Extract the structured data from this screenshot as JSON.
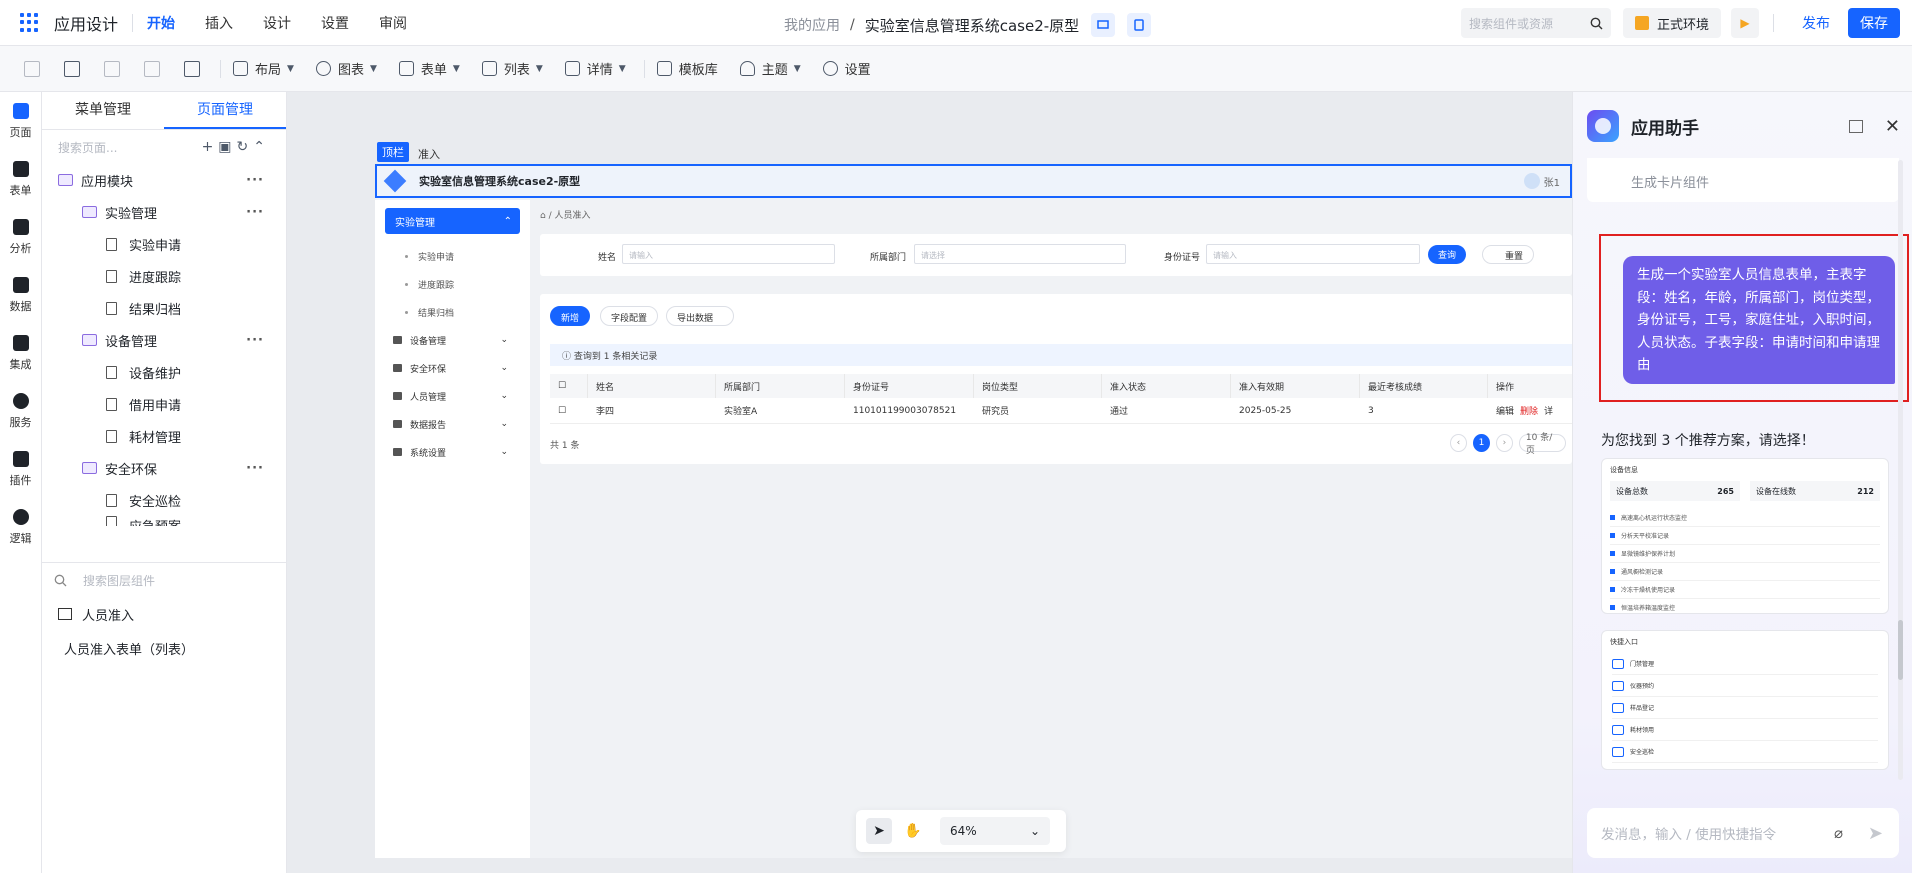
{
  "topbar": {
    "app_title": "应用设计",
    "menu": [
      "开始",
      "插入",
      "设计",
      "设置",
      "审阅"
    ],
    "crumb": "我的应用",
    "app_name": "实验室信息管理系统case2-原型",
    "search_placeholder": "搜索组件或资源",
    "env_label": "正式环境",
    "publish_label": "发布",
    "save_label": "保存"
  },
  "toolbar": {
    "items": [
      "布局",
      "图表",
      "表单",
      "列表",
      "详情",
      "模板库",
      "主题",
      "设置"
    ]
  },
  "left_rail": [
    "页面",
    "表单",
    "分析",
    "数据",
    "集成",
    "服务",
    "插件",
    "逻辑"
  ],
  "tree": {
    "tabs": [
      "菜单管理",
      "页面管理"
    ],
    "search_placeholder": "搜索页面...",
    "root": "应用模块",
    "groups": [
      {
        "name": "实验管理",
        "pages": [
          "实验申请",
          "进度跟踪",
          "结果归档"
        ]
      },
      {
        "name": "设备管理",
        "pages": [
          "设备维护",
          "借用申请",
          "耗材管理"
        ]
      },
      {
        "name": "安全环保",
        "pages": [
          "安全巡检",
          "应急预案"
        ]
      }
    ]
  },
  "layers": {
    "search_placeholder": "搜索图层组件",
    "page": "人员准入",
    "component": "人员准入表单（列表）"
  },
  "canvas": {
    "tag": "顶栏",
    "tag_tail": "准入",
    "header_title": "实验室信息管理系统case2-原型",
    "user": "张1",
    "side_active": "实验管理",
    "side_subs": [
      "实验申请",
      "进度跟踪",
      "结果归档"
    ],
    "side_items": [
      "设备管理",
      "安全环保",
      "人员管理",
      "数据报告",
      "系统设置"
    ],
    "crumb": "人员准入",
    "filter": {
      "name_label": "姓名",
      "name_ph": "请输入",
      "dept_label": "所属部门",
      "dept_ph": "请选择",
      "id_label": "身份证号",
      "id_ph": "请输入",
      "query": "查询",
      "reset": "重置"
    },
    "table": {
      "btn_add": "新增",
      "btn_field": "字段配置",
      "btn_export": "导出数据",
      "info": "查询到 1 条相关记录",
      "headers": [
        "姓名",
        "所属部门",
        "身份证号",
        "岗位类型",
        "准入状态",
        "准入有效期",
        "最近考核成绩",
        "操作"
      ],
      "row": [
        "李四",
        "实验室A",
        "110101199003078521",
        "研究员",
        "通过",
        "2025-05-25",
        "3"
      ],
      "actions": [
        "编辑",
        "删除",
        "详"
      ],
      "footer": "共 1 条",
      "page": "1",
      "page_size": "10 条/页"
    }
  },
  "zoom": "64%",
  "assistant": {
    "title": "应用助手",
    "prev_item": "生成卡片组件",
    "user_message": "生成一个实验室人员信息表单，主表字段：姓名，年龄，所属部门，岗位类型，身份证号，工号，家庭住址，入职时间，人员状态。子表字段：申请时间和申请理由",
    "answer": "为您找到 3 个推荐方案，请选择！",
    "rec1": {
      "title": "设备信息",
      "stats": [
        {
          "label": "设备总数",
          "value": "265"
        },
        {
          "label": "设备在线数",
          "value": "212"
        }
      ],
      "rows": [
        "高速离心机运行状态监控",
        "分析天平校准记录",
        "显微镜维护保养计划",
        "通风橱检测记录",
        "冷冻干燥机使用记录",
        "恒温培养箱温度监控"
      ]
    },
    "rec2": {
      "title": "快捷入口",
      "rows": [
        "门禁管理",
        "仪器预约",
        "样品登记",
        "耗材领用",
        "安全巡检"
      ]
    },
    "input_placeholder": "发消息，输入 / 使用快捷指令"
  },
  "colors": {
    "accent": "#1664ff",
    "bubble": "#6f5ee8",
    "highlight": "#e02020"
  }
}
